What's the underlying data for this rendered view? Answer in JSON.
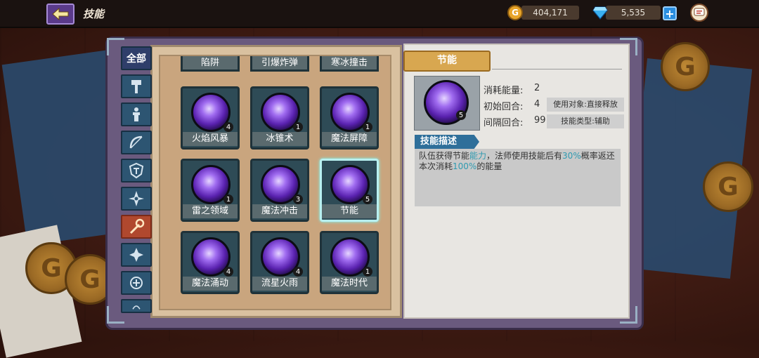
{
  "header": {
    "title": "技能",
    "gold": "404,171",
    "gems": "5,535"
  },
  "sidebar": {
    "all_label": "全部",
    "tabs": [
      "hammer-icon",
      "statue-icon",
      "bow-icon",
      "shield-icon",
      "shuriken-icon",
      "staff-icon",
      "cross-icon",
      "fist-icon",
      "more-icon"
    ]
  },
  "skills": {
    "top_row": [
      "陷阱",
      "引爆炸弹",
      "寒冰撞击"
    ],
    "cards": [
      {
        "name": "火焰风暴",
        "level": "4"
      },
      {
        "name": "冰锥术",
        "level": "1"
      },
      {
        "name": "魔法屏障",
        "level": "1"
      },
      {
        "name": "雷之领域",
        "level": "1"
      },
      {
        "name": "魔法冲击",
        "level": "3"
      },
      {
        "name": "节能",
        "level": "5"
      },
      {
        "name": "魔法涌动",
        "level": "4"
      },
      {
        "name": "流星火雨",
        "level": "4"
      },
      {
        "name": "魔法时代",
        "level": "1"
      }
    ]
  },
  "detail": {
    "title": "节能",
    "level": "5",
    "cost_label": "消耗能量:",
    "cost_value": "2",
    "initial_label": "初始回合:",
    "initial_value": "4",
    "interval_label": "间隔回合:",
    "interval_value": "99",
    "target_tag": "使用对象:直接释放",
    "type_tag": "技能类型:辅助",
    "desc_header": "技能描述",
    "desc_part1": "队伍获得节能",
    "desc_hl1": "能力",
    "desc_part2": "，法师使用技能后有",
    "desc_hl2": "30%",
    "desc_part3": "概率返还本次消耗",
    "desc_hl3": "100%",
    "desc_part4": "的能量"
  }
}
